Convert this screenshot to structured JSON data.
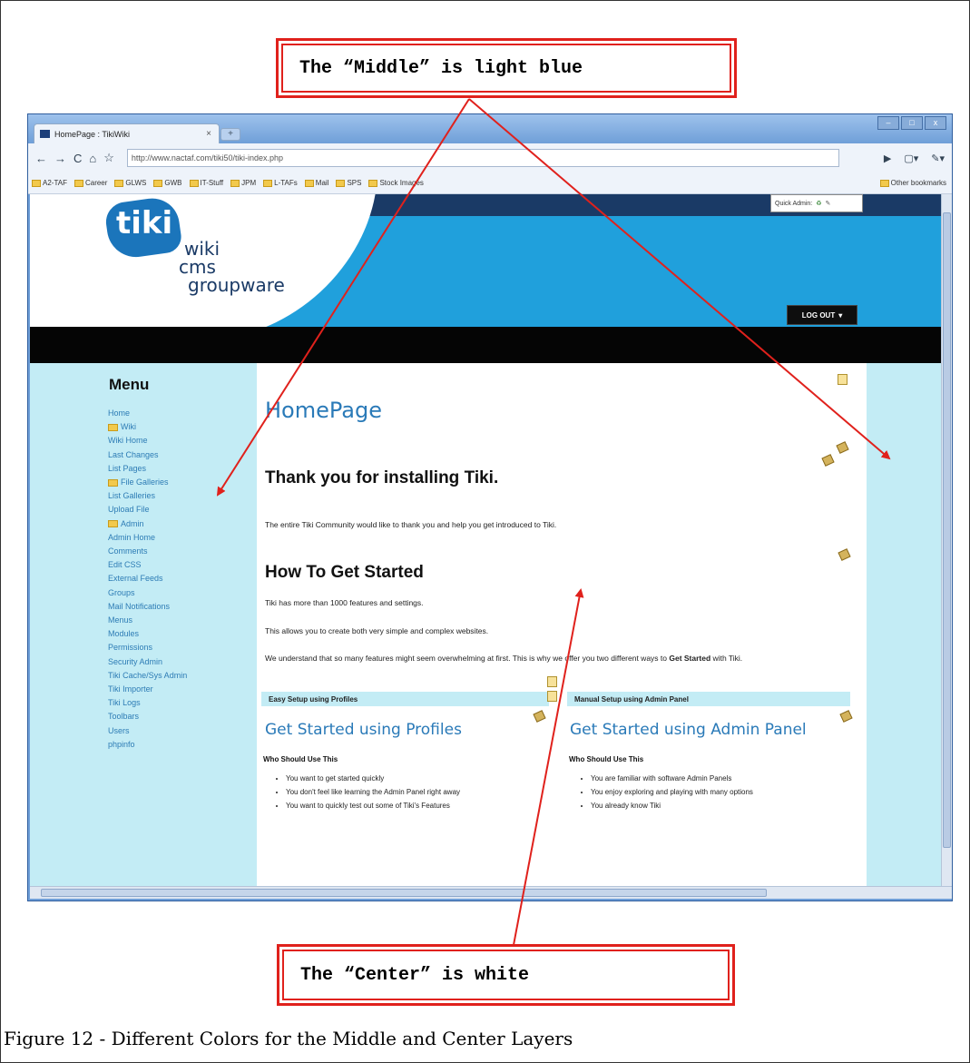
{
  "callouts": {
    "top": "The “Middle” is light blue",
    "bottom": "The “Center” is white"
  },
  "caption": "Figure 12 - Different Colors for the Middle and Center Layers",
  "browser": {
    "tab_title": "HomePage : TikiWiki",
    "url_domain": "http://www.nactaf.com",
    "url_path": "/tiki50/tiki-index.php",
    "bookmarks": [
      "A2-TAF",
      "Career",
      "GLWS",
      "GWB",
      "IT-Stuff",
      "JPM",
      "L-TAFs",
      "Mail",
      "SPS",
      "Stock Images"
    ],
    "other_bookmarks": "Other bookmarks",
    "colors": {
      "titlebar": "#6f9fd8",
      "toolbar": "#eef3fa"
    }
  },
  "site": {
    "logo_word": "tiki",
    "logo_lines": [
      "wiki",
      "cms",
      "groupware"
    ],
    "quick_admin": "Quick Admin:",
    "logout": "LOG OUT",
    "colors": {
      "middle": "#c3ecf5",
      "center": "#ffffff",
      "header": "#20a0dc",
      "link": "#2d7cb5"
    }
  },
  "menu": {
    "title": "Menu",
    "items": [
      {
        "label": "Home",
        "folder": false
      },
      {
        "label": "Wiki",
        "folder": true
      },
      {
        "label": "Wiki Home",
        "folder": false
      },
      {
        "label": "Last Changes",
        "folder": false
      },
      {
        "label": "List Pages",
        "folder": false
      },
      {
        "label": "File Galleries",
        "folder": true
      },
      {
        "label": "List Galleries",
        "folder": false
      },
      {
        "label": "Upload File",
        "folder": false
      },
      {
        "label": "Admin",
        "folder": true
      },
      {
        "label": "Admin Home",
        "folder": false
      },
      {
        "label": "Comments",
        "folder": false
      },
      {
        "label": "Edit CSS",
        "folder": false
      },
      {
        "label": "External Feeds",
        "folder": false
      },
      {
        "label": "Groups",
        "folder": false
      },
      {
        "label": "Mail Notifications",
        "folder": false
      },
      {
        "label": "Menus",
        "folder": false
      },
      {
        "label": "Modules",
        "folder": false
      },
      {
        "label": "Permissions",
        "folder": false
      },
      {
        "label": "Security Admin",
        "folder": false
      },
      {
        "label": "Tiki Cache/Sys Admin",
        "folder": false
      },
      {
        "label": "Tiki Importer",
        "folder": false
      },
      {
        "label": "Tiki Logs",
        "folder": false
      },
      {
        "label": "Toolbars",
        "folder": false
      },
      {
        "label": "Users",
        "folder": false
      },
      {
        "label": "phpinfo",
        "folder": false
      }
    ]
  },
  "content": {
    "page_title": "HomePage",
    "thank_heading": "Thank you for installing Tiki.",
    "thank_text": "The entire Tiki Community would like to thank you and help you get introduced to Tiki.",
    "how_heading": "How To Get Started",
    "para1": "Tiki has more than 1000 features and settings.",
    "para2": "This allows you to create both very simple and complex websites.",
    "para3_a": "We understand that so many features might seem overwhelming at first. This is why we offer you two different ways to ",
    "para3_b": "Get Started",
    "para3_c": " with Tiki.",
    "left_box": {
      "header": "Easy Setup using Profiles",
      "title": "Get Started using Profiles",
      "who": "Who Should Use This",
      "bullets": [
        "You want to get started quickly",
        "You don't feel like learning the Admin Panel right away",
        "You want to quickly test out some of Tiki's Features"
      ]
    },
    "right_box": {
      "header": "Manual Setup using Admin Panel",
      "title": "Get Started using Admin Panel",
      "who": "Who Should Use This",
      "bullets": [
        "You are familiar with software Admin Panels",
        "You enjoy exploring and playing with many options",
        "You already know Tiki"
      ]
    }
  }
}
